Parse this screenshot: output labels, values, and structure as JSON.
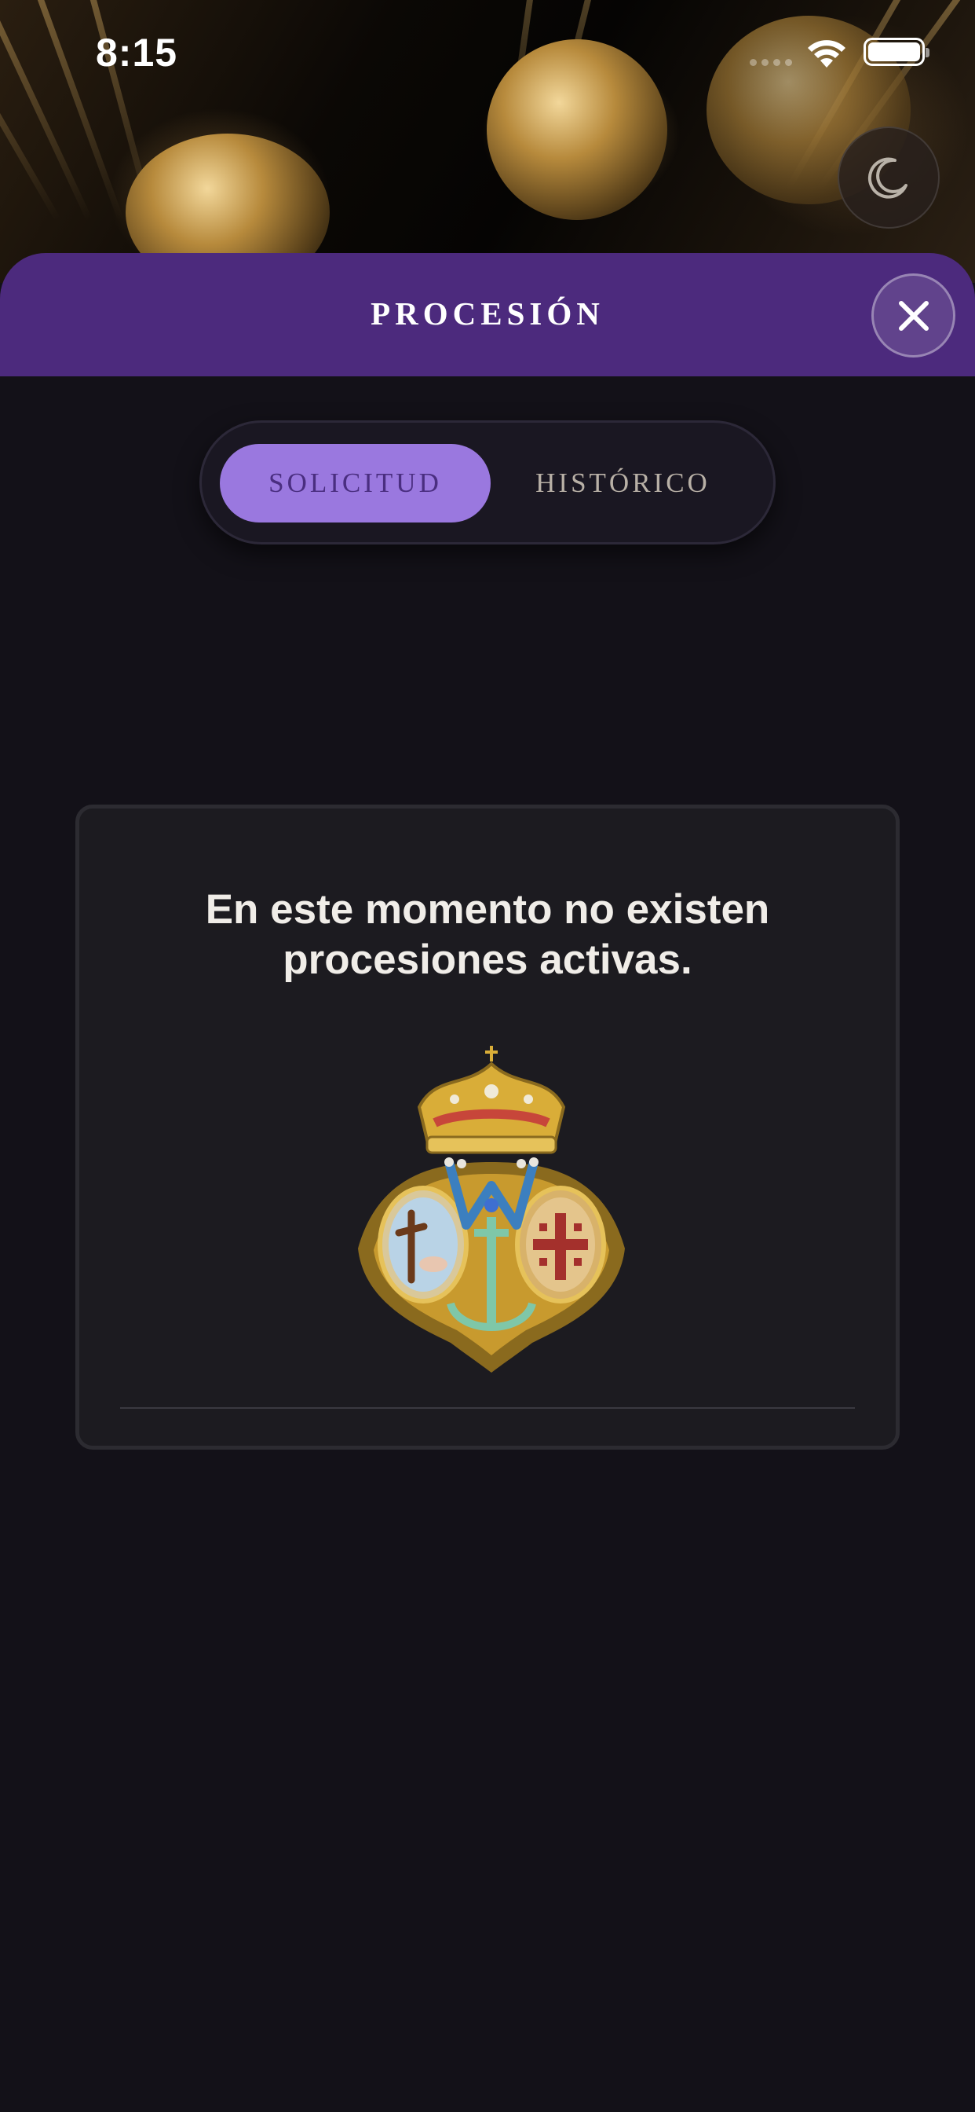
{
  "status_bar": {
    "time": "8:15"
  },
  "header": {
    "title": "PROCESIÓN"
  },
  "tabs": [
    {
      "label": "SOLICITUD",
      "active": true
    },
    {
      "label": "HISTÓRICO",
      "active": false
    }
  ],
  "card": {
    "message": "En este momento no existen procesiones activas.",
    "emblem_icon": "brotherhood-crest-icon"
  },
  "colors": {
    "header_purple": "#4c2a7d",
    "tab_active": "#9a78df",
    "background": "#131118"
  }
}
